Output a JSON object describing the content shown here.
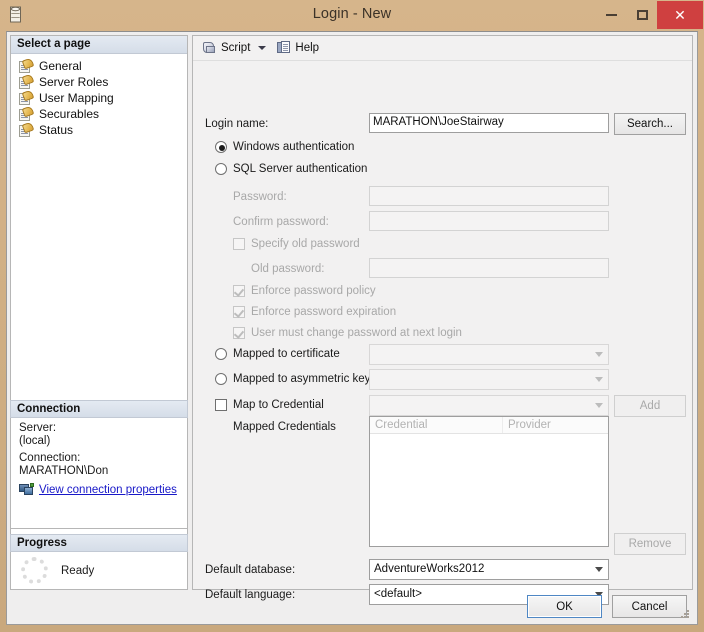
{
  "window": {
    "title": "Login - New",
    "icon": "database-icon",
    "minimize_label": "–",
    "maximize_label": "□",
    "close_label": "✕",
    "close_color": "#cf4040",
    "titlebar_color": "#cfae83"
  },
  "sidebar": {
    "page_section_title": "Select a page",
    "items": [
      {
        "label": "General",
        "icon": "page-wrench-icon"
      },
      {
        "label": "Server Roles",
        "icon": "page-wrench-icon"
      },
      {
        "label": "User Mapping",
        "icon": "page-wrench-icon"
      },
      {
        "label": "Securables",
        "icon": "page-wrench-icon"
      },
      {
        "label": "Status",
        "icon": "page-wrench-icon"
      }
    ],
    "connection": {
      "section_title": "Connection",
      "server_label": "Server:",
      "server_value": "(local)",
      "connection_label": "Connection:",
      "connection_value": "MARATHON\\Don",
      "properties_link": "View connection properties",
      "properties_link_color": "#1818c8",
      "properties_icon": "network-connection-icon"
    },
    "progress": {
      "section_title": "Progress",
      "status": "Ready",
      "spinner_icon": "progress-spinner-icon"
    }
  },
  "toolbar": {
    "script_label": "Script",
    "script_icon": "script-scroll-icon",
    "script_dropdown_icon": "chevron-down-icon",
    "help_label": "Help",
    "help_icon": "help-pages-icon"
  },
  "form": {
    "login_name_label": "Login name:",
    "login_name_value": "MARATHON\\JoeStairway",
    "search_button": "Search...",
    "auth": {
      "windows_label": "Windows authentication",
      "windows_selected": true,
      "sql_label": "SQL Server authentication",
      "sql_selected": false
    },
    "password_label": "Password:",
    "password_value": "",
    "confirm_password_label": "Confirm password:",
    "confirm_password_value": "",
    "specify_old_password_label": "Specify old password",
    "specify_old_password_checked": false,
    "old_password_label": "Old password:",
    "old_password_value": "",
    "enforce_policy_label": "Enforce password policy",
    "enforce_policy_checked": true,
    "enforce_expiration_label": "Enforce password expiration",
    "enforce_expiration_checked": true,
    "must_change_label": "User must change password at next login",
    "must_change_checked": true,
    "mapped_certificate_label": "Mapped to certificate",
    "mapped_certificate_selected": false,
    "mapped_certificate_value": "",
    "mapped_asymmetric_label": "Mapped to asymmetric key",
    "mapped_asymmetric_selected": false,
    "mapped_asymmetric_value": "",
    "map_credential_label": "Map to Credential",
    "map_credential_checked": false,
    "map_credential_value": "",
    "add_button": "Add",
    "mapped_credentials_label": "Mapped Credentials",
    "credentials_columns": [
      "Credential",
      "Provider"
    ],
    "credentials_rows": [],
    "remove_button": "Remove",
    "default_database_label": "Default database:",
    "default_database_value": "AdventureWorks2012",
    "default_language_label": "Default language:",
    "default_language_value": "<default>"
  },
  "footer": {
    "ok_label": "OK",
    "cancel_label": "Cancel",
    "resize_grip_icon": "resize-grip-icon"
  }
}
